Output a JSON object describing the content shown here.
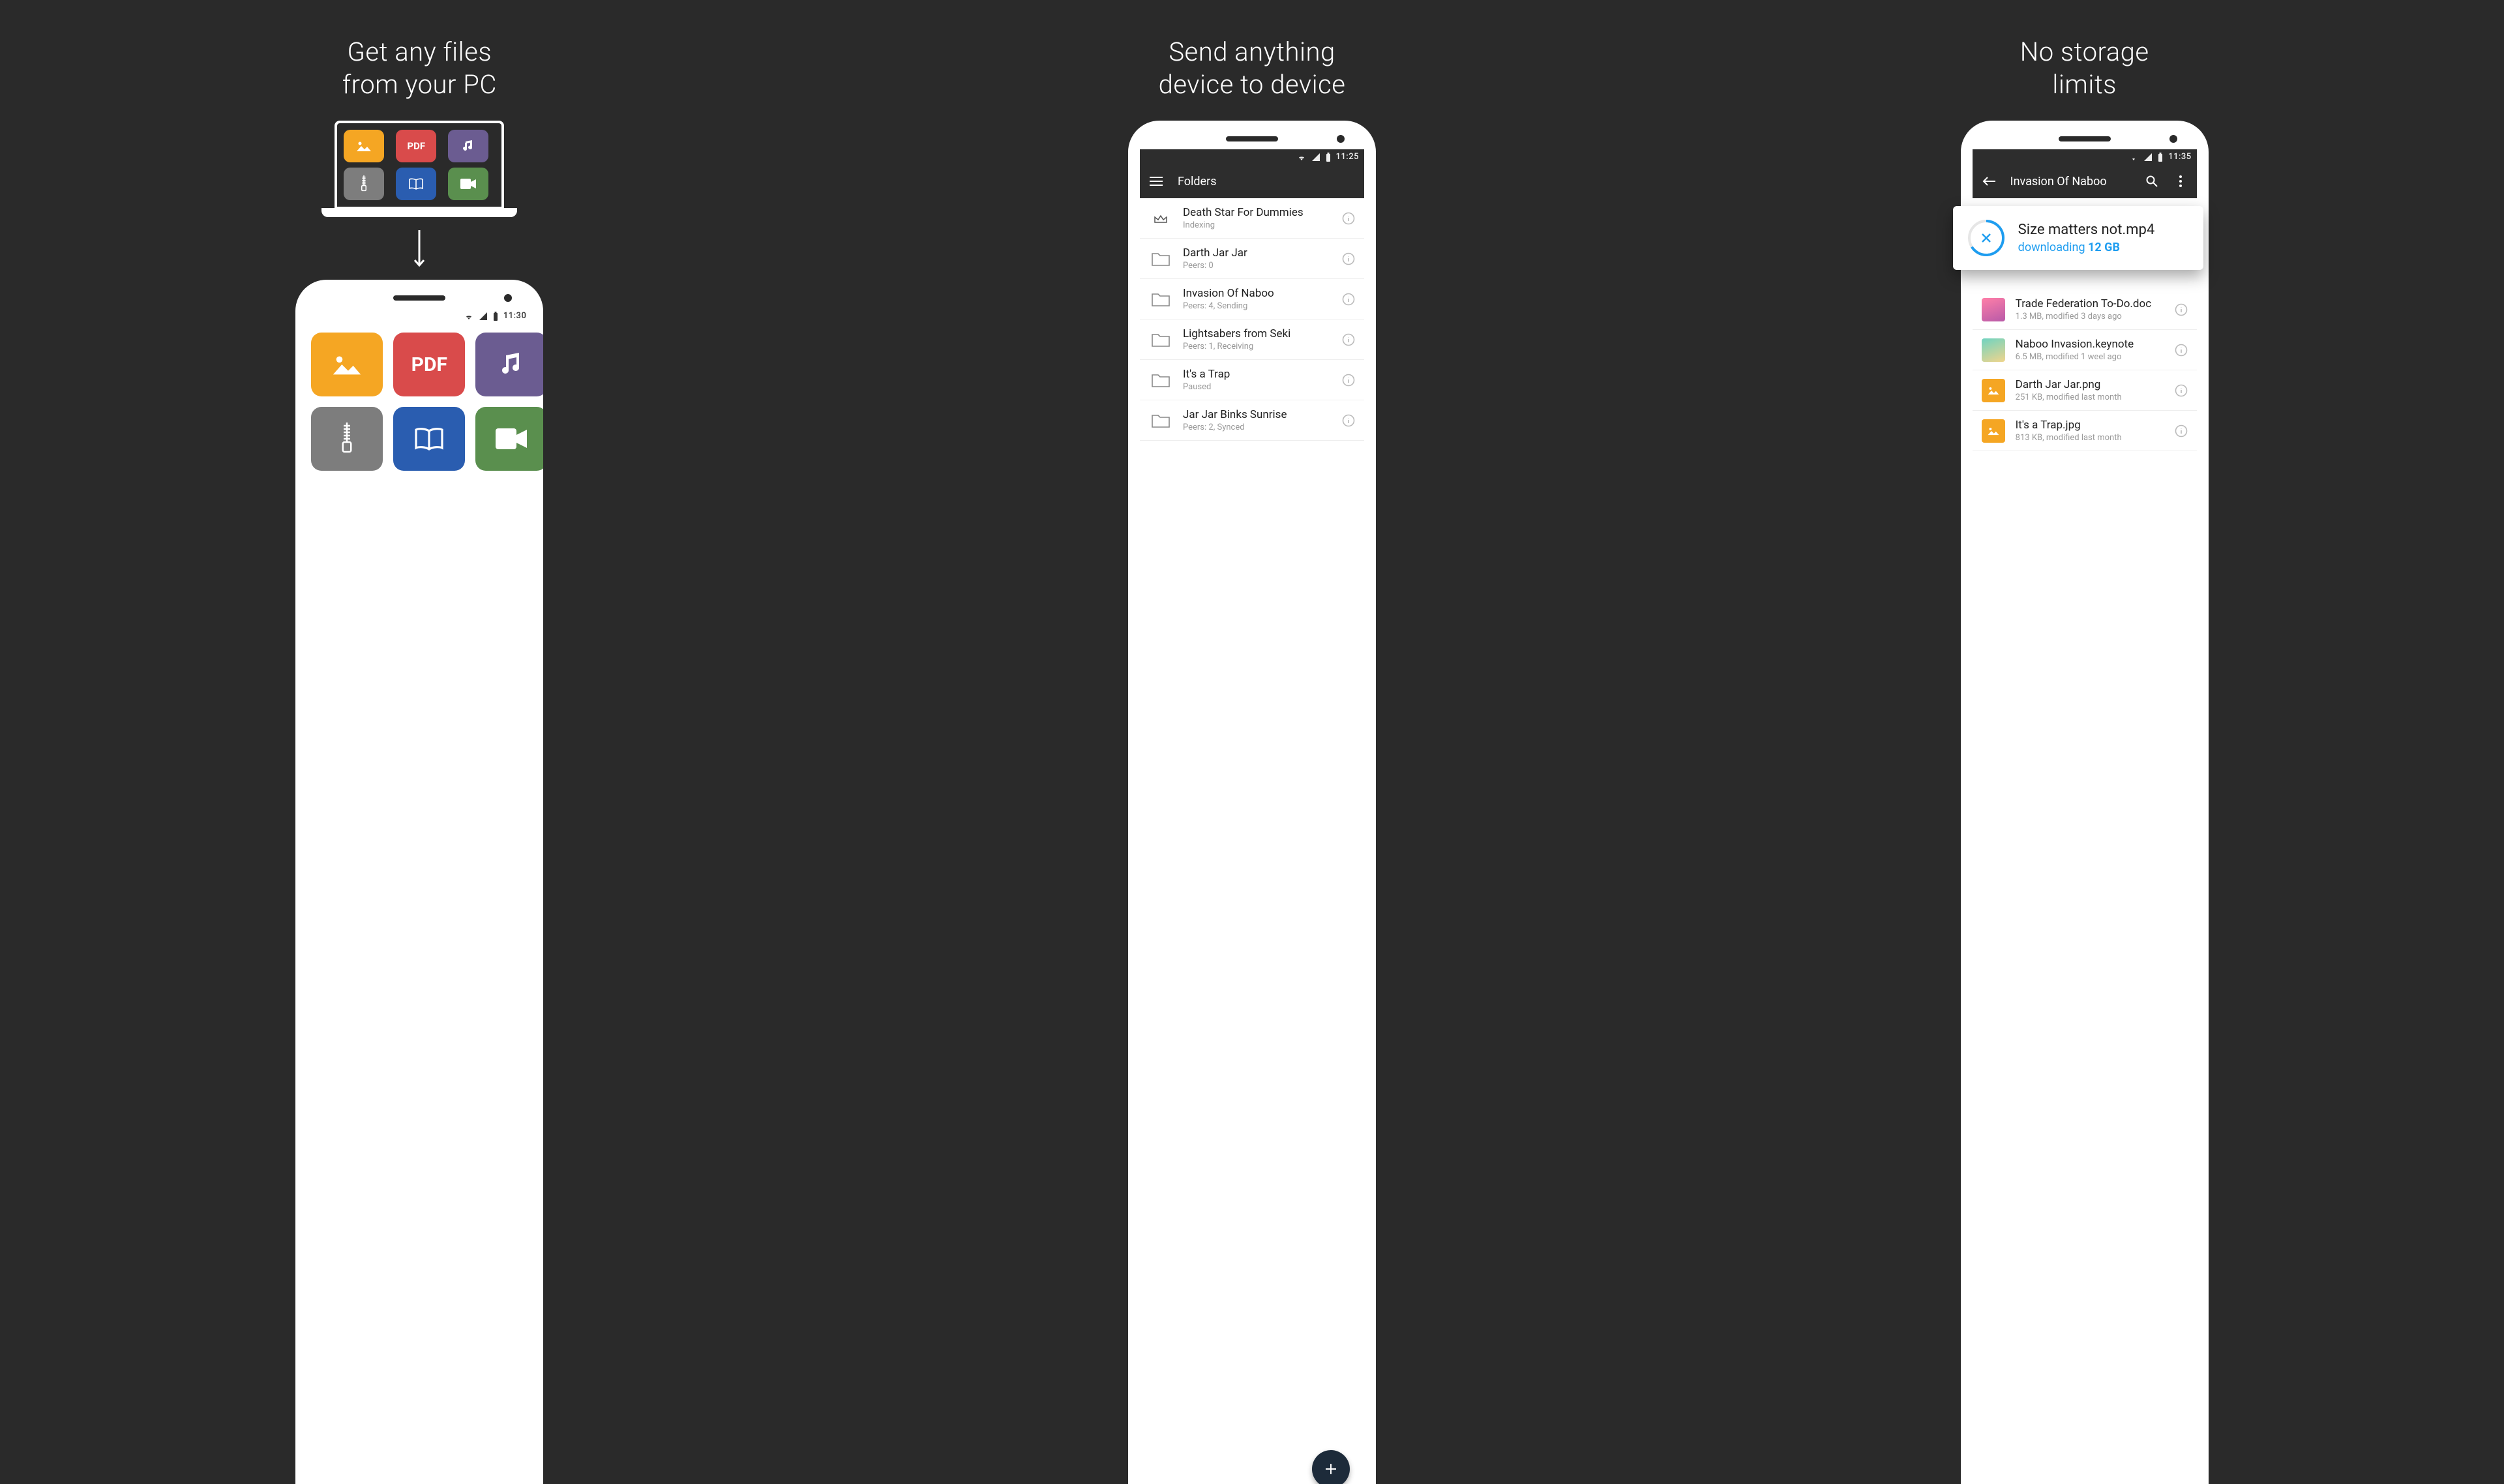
{
  "col1": {
    "headline": "Get any files\nfrom your PC",
    "status_time": "11:30",
    "tiles": {
      "pdf": "PDF"
    }
  },
  "col2": {
    "headline": "Send anything\ndevice to device",
    "status_time": "11:25",
    "appbar_title": "Folders",
    "folders": [
      {
        "title": "Death Star For Dummies",
        "sub": "Indexing",
        "icon": "crown"
      },
      {
        "title": "Darth Jar Jar",
        "sub": "Peers: 0"
      },
      {
        "title": "Invasion Of Naboo",
        "sub": "Peers: 4, Sending"
      },
      {
        "title": "Lightsabers from Seki",
        "sub": "Peers: 1, Receiving"
      },
      {
        "title": "It's a Trap",
        "sub": "Paused"
      },
      {
        "title": "Jar Jar Binks Sunrise",
        "sub": "Peers: 2, Synced"
      }
    ]
  },
  "col3": {
    "headline": "No storage\nlimits",
    "status_time": "11:35",
    "appbar_title": "Invasion Of Naboo",
    "download": {
      "filename": "Size matters not.mp4",
      "status_label": "downloading",
      "status_value": "12 GB"
    },
    "files": [
      {
        "title": "Trade Federation To-Do.doc",
        "sub": "1.3 MB, modified 3 days ago",
        "thumb": "pink"
      },
      {
        "title": "Naboo Invasion.keynote",
        "sub": "6.5 MB, modified 1 weel ago",
        "thumb": "teal"
      },
      {
        "title": "Darth Jar Jar.png",
        "sub": "251 KB, modified last month",
        "thumb": "orange"
      },
      {
        "title": "It's a Trap.jpg",
        "sub": "813 KB, modified last month",
        "thumb": "orange"
      }
    ]
  }
}
